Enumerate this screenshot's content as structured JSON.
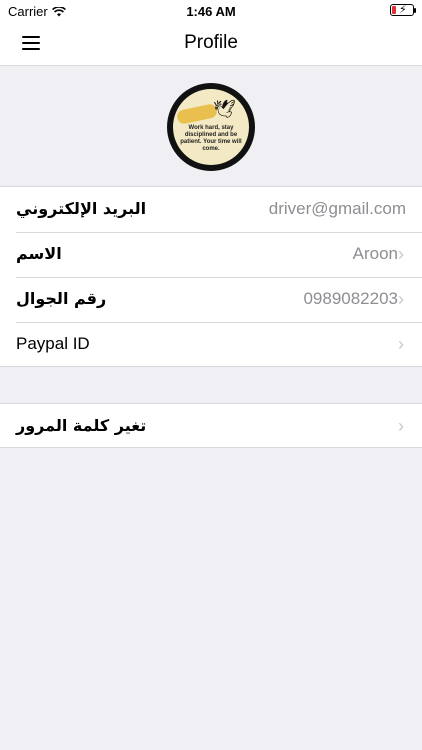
{
  "status_bar": {
    "carrier": "Carrier",
    "time": "1:46 AM"
  },
  "nav": {
    "title": "Profile"
  },
  "avatar": {
    "quote": "Work hard, stay disciplined and be patient. Your time will come."
  },
  "profile_rows": [
    {
      "label": "البريد الإلكتروني",
      "value": "driver@gmail.com"
    },
    {
      "label": "الاسم",
      "value": "Aroon"
    },
    {
      "label": "رقم الجوال",
      "value": "0989082203"
    },
    {
      "label": "Paypal ID",
      "value": ""
    }
  ],
  "password_row": {
    "label": "تغير كلمة المرور"
  },
  "colors": {
    "background": "#efeff4",
    "separator": "#d8d8dc",
    "secondary_text": "#8e8e93"
  }
}
